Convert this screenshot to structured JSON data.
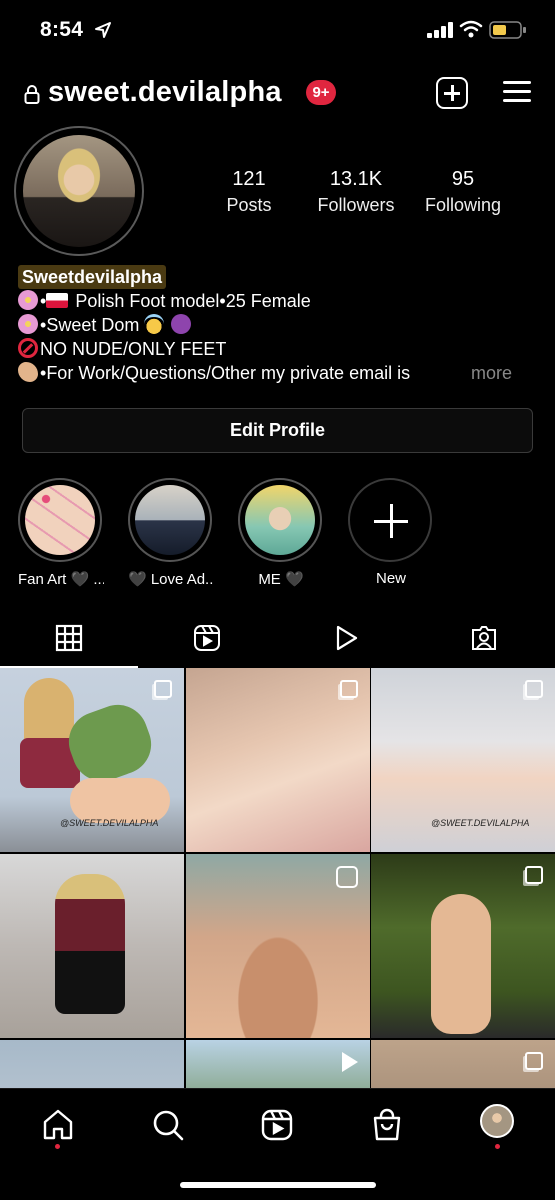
{
  "status_bar": {
    "time": "8:54"
  },
  "header": {
    "username": "sweet.devilalpha",
    "notification_badge": "9+"
  },
  "profile": {
    "stats": [
      {
        "value": "121",
        "label": "Posts"
      },
      {
        "value": "13.1K",
        "label": "Followers"
      },
      {
        "value": "95",
        "label": "Following"
      }
    ],
    "display_name": "Sweetdevilalpha",
    "bio_lines": [
      "Polish Foot model•25 Female",
      "Sweet Dom",
      "NO NUDE/ONLY FEET",
      "For Work/Questions/Other my private email is"
    ],
    "bio_bullet": "•",
    "more_label": "more",
    "edit_profile_label": "Edit Profile"
  },
  "highlights": [
    {
      "label": "Fan Art 🖤 ..."
    },
    {
      "label": "🖤 Love Ad..."
    },
    {
      "label": "ME 🖤"
    },
    {
      "label": "New"
    }
  ],
  "tabs": [
    {
      "icon": "grid-icon",
      "active": true
    },
    {
      "icon": "reels-icon",
      "active": false
    },
    {
      "icon": "video-play-icon",
      "active": false
    },
    {
      "icon": "tagged-icon",
      "active": false
    }
  ],
  "grid_posts": [
    {
      "type": "carousel",
      "overlay_text": "@SWEET.DEVILALPHA"
    },
    {
      "type": "carousel",
      "overlay_text": ""
    },
    {
      "type": "carousel",
      "overlay_text": "@SWEET.DEVILALPHA"
    },
    {
      "type": "photo",
      "overlay_text": ""
    },
    {
      "type": "reel",
      "overlay_text": ""
    },
    {
      "type": "carousel",
      "overlay_text": ""
    },
    {
      "type": "photo",
      "overlay_text": ""
    },
    {
      "type": "video",
      "overlay_text": ""
    },
    {
      "type": "carousel",
      "overlay_text": ""
    }
  ],
  "bottom_nav": [
    {
      "icon": "home-icon",
      "active": true
    },
    {
      "icon": "search-icon",
      "active": false
    },
    {
      "icon": "reels-icon",
      "active": false
    },
    {
      "icon": "shop-icon",
      "active": false
    },
    {
      "icon": "profile-avatar",
      "active": false
    }
  ],
  "colors": {
    "background": "#000000",
    "badge": "#e0263f",
    "highlight_name_bg": "#4a3a12",
    "muted_text": "#888888"
  }
}
